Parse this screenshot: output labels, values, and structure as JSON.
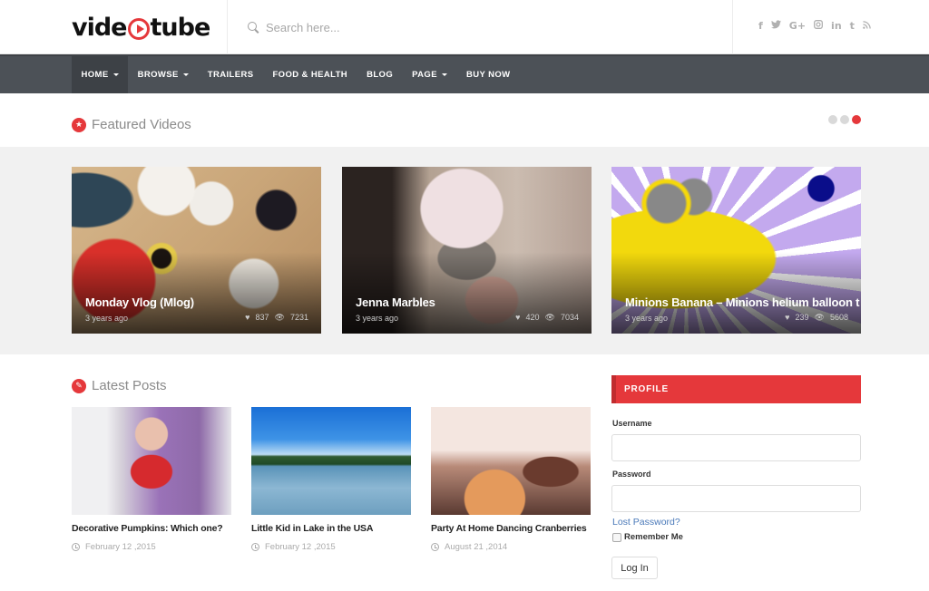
{
  "brand": {
    "logo_left": "vide",
    "logo_right": "tube",
    "accent_color": "#e5383b"
  },
  "search": {
    "placeholder": "Search here..."
  },
  "social": [
    {
      "icon": "facebook-icon",
      "glyph": "f"
    },
    {
      "icon": "twitter-icon",
      "glyph": "🐦"
    },
    {
      "icon": "google-plus-icon",
      "glyph": "G+"
    },
    {
      "icon": "instagram-icon",
      "glyph": "◎"
    },
    {
      "icon": "linkedin-icon",
      "glyph": "in"
    },
    {
      "icon": "tumblr-icon",
      "glyph": "t"
    },
    {
      "icon": "rss-icon",
      "glyph": "⋰"
    }
  ],
  "nav": {
    "items": [
      {
        "label": "HOME",
        "dropdown": true,
        "active": true
      },
      {
        "label": "BROWSE",
        "dropdown": true
      },
      {
        "label": "TRAILERS"
      },
      {
        "label": "FOOD & HEALTH"
      },
      {
        "label": "BLOG"
      },
      {
        "label": "PAGE",
        "dropdown": true
      },
      {
        "label": "BUY NOW"
      }
    ]
  },
  "featured": {
    "title": "Featured Videos",
    "slider": {
      "total_pages": 3,
      "active_page": 3
    },
    "videos": [
      {
        "title": "Monday Vlog (Mlog)",
        "age": "3 years ago",
        "likes": "837",
        "views": "7231"
      },
      {
        "title": "Jenna Marbles",
        "age": "3 years ago",
        "likes": "420",
        "views": "7034"
      },
      {
        "title": "Minions Banana – Minions helium balloon t",
        "age": "3 years ago",
        "likes": "239",
        "views": "5608"
      }
    ]
  },
  "latest": {
    "title": "Latest Posts",
    "posts": [
      {
        "title": "Decorative Pumpkins: Which one?",
        "date": "February 12 ,2015"
      },
      {
        "title": "Little Kid in Lake in the USA",
        "date": "February 12 ,2015"
      },
      {
        "title": "Party At Home Dancing Cranberries",
        "date": "August 21 ,2014"
      }
    ]
  },
  "profile": {
    "heading": "PROFILE",
    "username_label": "Username",
    "username_value": "",
    "password_label": "Password",
    "password_value": "",
    "lost_password": "Lost Password?",
    "remember_label": "Remember Me",
    "remember_checked": false,
    "login_button": "Log In"
  }
}
